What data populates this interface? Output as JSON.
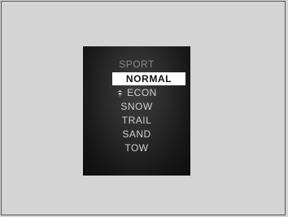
{
  "drive_mode_menu": {
    "items": [
      {
        "label": "SPORT",
        "state": "dim"
      },
      {
        "label": "NORMAL",
        "state": "selected"
      },
      {
        "label": "ECON",
        "state": "normal",
        "icon": "econ-leaf-icon"
      },
      {
        "label": "SNOW",
        "state": "normal"
      },
      {
        "label": "TRAIL",
        "state": "normal"
      },
      {
        "label": "SAND",
        "state": "normal"
      },
      {
        "label": "TOW",
        "state": "normal"
      }
    ],
    "selected_index": 1
  },
  "colors": {
    "page_background": "#d4d4d4",
    "frame_border": "#555555",
    "highlight_background": "#ffffff",
    "highlight_text": "#111111",
    "item_text": "#cfcfcf",
    "dim_text": "#8a8a8a"
  }
}
